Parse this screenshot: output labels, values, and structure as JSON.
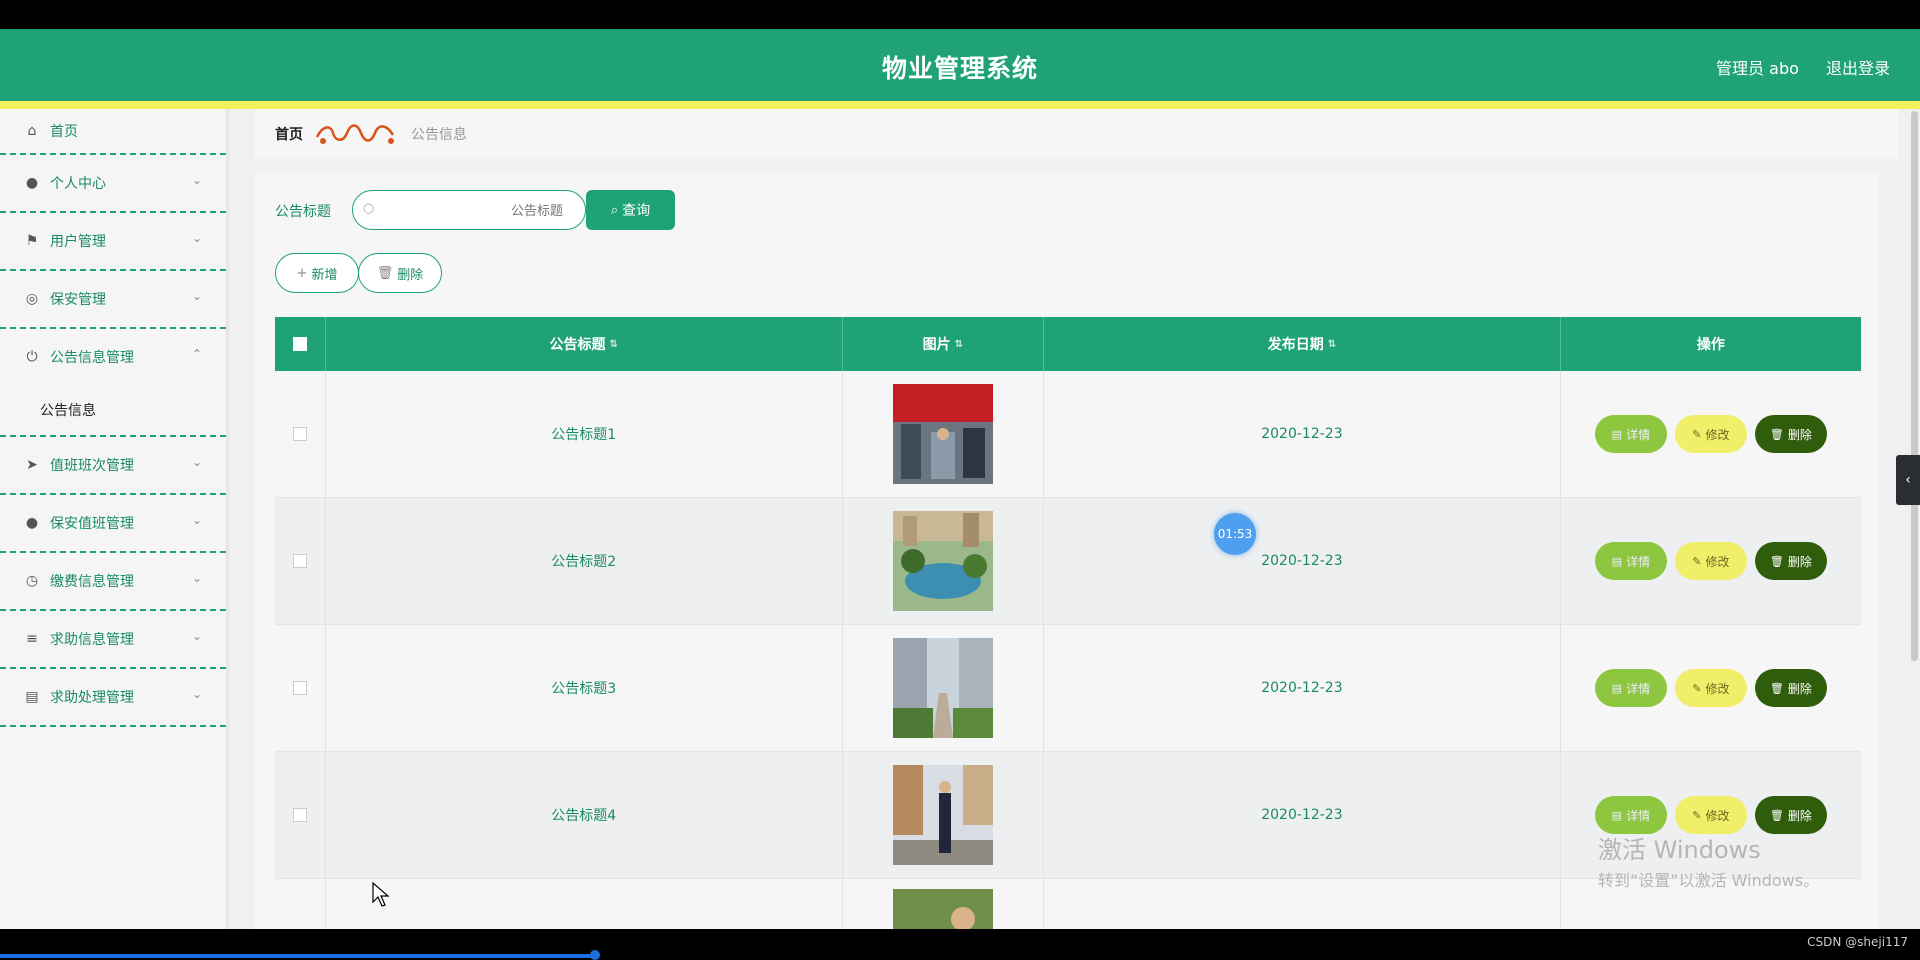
{
  "header": {
    "title": "物业管理系统",
    "user": "管理员 abo",
    "logout": "退出登录"
  },
  "sidebar": {
    "home": "首页",
    "items": [
      {
        "label": "个人中心",
        "icon": "user-icon"
      },
      {
        "label": "用户管理",
        "icon": "flag-icon"
      },
      {
        "label": "保安管理",
        "icon": "gauge-icon"
      },
      {
        "label": "公告信息管理",
        "icon": "power-icon",
        "expanded": true
      },
      {
        "label": "值班班次管理",
        "icon": "send-icon"
      },
      {
        "label": "保安值班管理",
        "icon": "user-icon"
      },
      {
        "label": "缴费信息管理",
        "icon": "clock-icon"
      },
      {
        "label": "求助信息管理",
        "icon": "list-icon"
      },
      {
        "label": "求助处理管理",
        "icon": "printer-icon"
      }
    ],
    "submenu": "公告信息"
  },
  "breadcrumb": {
    "home": "首页",
    "current": "公告信息"
  },
  "search": {
    "label": "公告标题",
    "placeholder": "公告标题",
    "button": "查询"
  },
  "actions": {
    "add": "新增",
    "delete": "删除"
  },
  "table": {
    "headers": [
      "公告标题",
      "图片",
      "发布日期",
      "操作"
    ],
    "rows": [
      {
        "title": "公告标题1",
        "date": "2020-12-23"
      },
      {
        "title": "公告标题2",
        "date": "2020-12-23"
      },
      {
        "title": "公告标题3",
        "date": "2020-12-23"
      },
      {
        "title": "公告标题4",
        "date": "2020-12-23"
      }
    ],
    "row_buttons": {
      "detail": "详情",
      "edit": "修改",
      "delete": "删除"
    }
  },
  "overlay": {
    "timer": "01:53",
    "watermark_line1": "激活 Windows",
    "watermark_line2": "转到“设置”以激活 Windows。",
    "credit": "CSDN @sheji117",
    "video_progress": 0.31
  },
  "colors": {
    "primary": "#1fa277",
    "accent_bar": "#f2f05c",
    "detail": "#8dc63f",
    "edit": "#f0ef6a",
    "delete": "#2f5d0c"
  }
}
